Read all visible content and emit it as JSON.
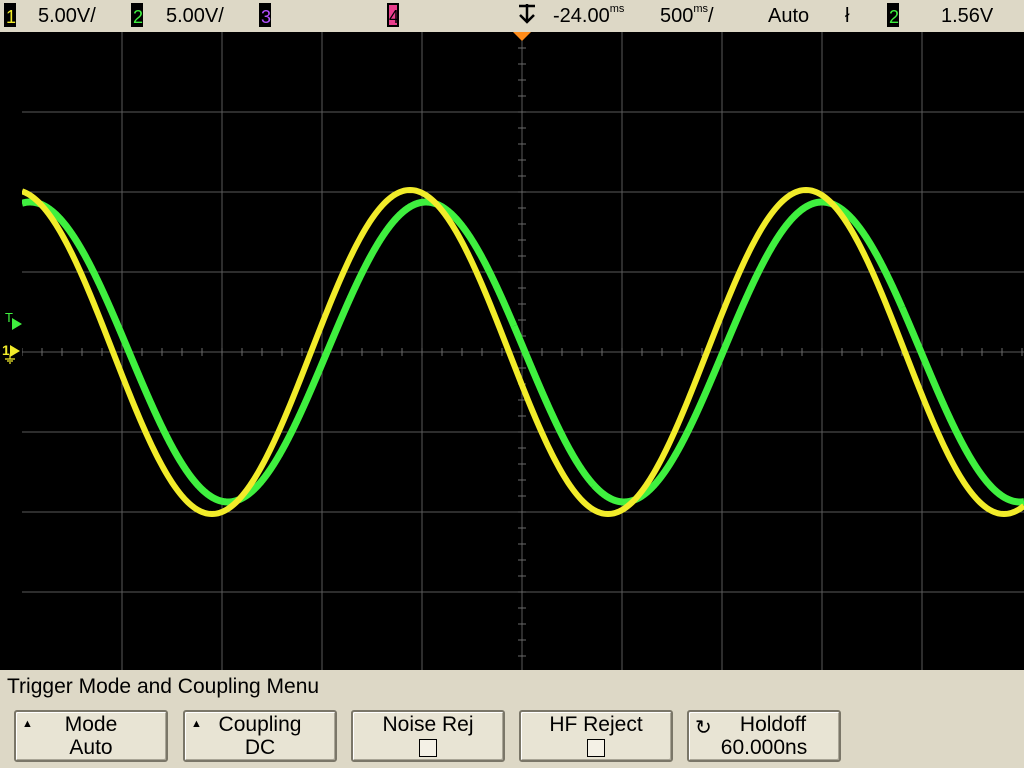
{
  "status": {
    "ch1": {
      "number": "1",
      "scale": "5.00V/"
    },
    "ch2": {
      "number": "2",
      "scale": "5.00V/"
    },
    "ch3": {
      "number": "3"
    },
    "ch4": {
      "number": "4"
    },
    "time_position": "-24.00",
    "time_position_unit": "ms",
    "time_scale": "500",
    "time_scale_unit": "ms",
    "time_scale_suffix": "/",
    "trigger_mode": "Auto",
    "trigger_slope_symbol": "ł",
    "trigger_source": "2",
    "trigger_level": "1.56V"
  },
  "screen": {
    "trigger_marker_label": "T",
    "ground_marker_label": "1"
  },
  "menu": {
    "title": "Trigger Mode and Coupling Menu",
    "softkeys": [
      {
        "line1": "Mode",
        "line2": "Auto"
      },
      {
        "line1": "Coupling",
        "line2": "DC"
      },
      {
        "line1": "Noise Rej"
      },
      {
        "line1": "HF Reject"
      },
      {
        "line1": "Holdoff",
        "line2": "60.000ns"
      }
    ]
  },
  "colors": {
    "ch1": "#f2ec2a",
    "ch2": "#3ff03f",
    "ch3": "#b350ff",
    "ch4": "#e83e8c",
    "grid": "#5a5a5a",
    "trigger_arrow": "#ff8c1a"
  }
}
